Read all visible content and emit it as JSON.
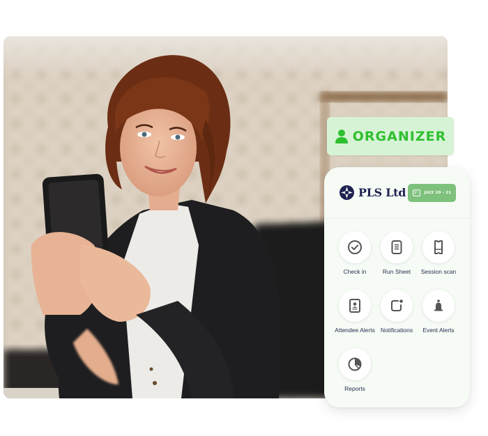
{
  "hero": {
    "photo_alt": "Smiling woman in a black blazer holding a smartphone"
  },
  "role_badge": {
    "icon": "person-icon",
    "label": "ORGANIZER",
    "bg_color": "#d7f3d6",
    "text_color": "#2fc02f"
  },
  "app": {
    "brand": {
      "logo_icon": "compass-star-logo",
      "name": "PLS Ltd",
      "color": "#1f2352"
    },
    "date_chip": {
      "icon": "calendar-icon",
      "label": "JULY 20 - 21",
      "bg_color": "#7ec17c"
    },
    "tiles": [
      {
        "icon": "check-circle-icon",
        "label": "Check in"
      },
      {
        "icon": "document-icon",
        "label": "Run Sheet"
      },
      {
        "icon": "ticket-icon",
        "label": "Session scan"
      },
      {
        "icon": "id-badge-icon",
        "label": "Attendee Alerts"
      },
      {
        "icon": "notification-icon",
        "label": "Notifications"
      },
      {
        "icon": "bell-icon",
        "label": "Event Alerts"
      },
      {
        "icon": "pie-chart-icon",
        "label": "Reports"
      }
    ]
  }
}
